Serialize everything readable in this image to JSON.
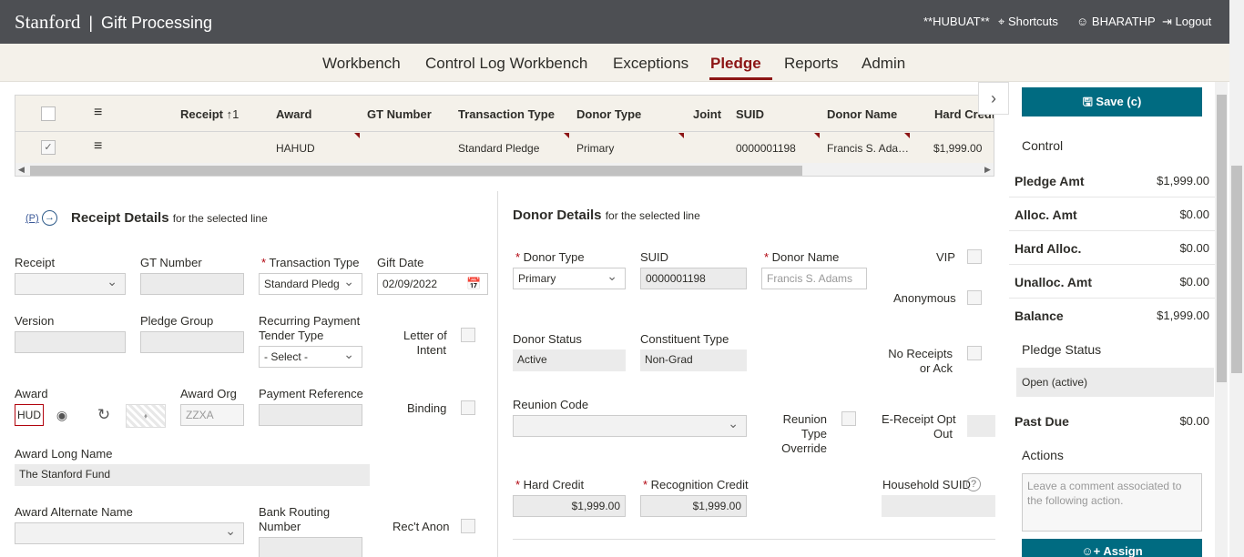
{
  "header": {
    "brand": "Stanford",
    "app_name": "Gift Processing",
    "env": "**HUBUAT**",
    "shortcuts": "Shortcuts",
    "user": "BHARATHP",
    "logout": "Logout"
  },
  "nav": {
    "items": [
      "Workbench",
      "Control Log Workbench",
      "Exceptions",
      "Pledge",
      "Reports",
      "Admin"
    ],
    "active": "Pledge"
  },
  "grid": {
    "columns": [
      "Receipt",
      "Award",
      "GT Number",
      "Transaction Type",
      "Donor Type",
      "Joint",
      "SUID",
      "Donor Name",
      "Hard Credit"
    ],
    "sort_indicator": "↑1",
    "row": {
      "award": "HAHUD",
      "transaction_type": "Standard Pledge",
      "donor_type": "Primary",
      "suid": "0000001198",
      "donor_name": "Francis S. Ada…",
      "hard_credit": "$1,999.00"
    }
  },
  "receipt": {
    "badge": "(P)",
    "title": "Receipt Details",
    "subtitle": "for the selected line",
    "labels": {
      "receipt": "Receipt",
      "gt_number": "GT Number",
      "transaction_type": "Transaction Type",
      "gift_date": "Gift Date",
      "version": "Version",
      "pledge_group": "Pledge Group",
      "recurring_1": "Recurring Payment",
      "recurring_2": "Tender Type",
      "letter_1": "Letter of",
      "letter_2": "Intent",
      "award": "Award",
      "award_org": "Award Org",
      "payment_reference": "Payment Reference",
      "binding": "Binding",
      "award_long_name": "Award Long Name",
      "award_alternate_name": "Award Alternate Name",
      "bank_1": "Bank Routing",
      "bank_2": "Number",
      "rect_anon": "Rec't Anon"
    },
    "values": {
      "transaction_type": "Standard Pledg",
      "gift_date": "02/09/2022",
      "recurring_tender": "- Select -",
      "award": "HUD",
      "award_org": "ZZXA",
      "award_long_name": "The Stanford Fund"
    }
  },
  "donor": {
    "title": "Donor Details",
    "subtitle": "for the selected line",
    "labels": {
      "donor_type": "Donor Type",
      "suid": "SUID",
      "donor_name": "Donor Name",
      "vip": "VIP",
      "anonymous": "Anonymous",
      "donor_status": "Donor Status",
      "constituent_type": "Constituent Type",
      "no_receipts_1": "No Receipts",
      "no_receipts_2": "or Ack",
      "reunion_code": "Reunion Code",
      "reunion_override_1": "Reunion",
      "reunion_override_2": "Type",
      "reunion_override_3": "Override",
      "ereceipt_1": "E-Receipt Opt",
      "ereceipt_2": "Out",
      "hard_credit": "Hard Credit",
      "recognition_credit": "Recognition Credit",
      "household_suid": "Household SUID"
    },
    "values": {
      "donor_type": "Primary",
      "suid": "0000001198",
      "donor_name": "Francis S. Adams",
      "donor_status": "Active",
      "constituent_type": "Non-Grad",
      "hard_credit": "$1,999.00",
      "recognition_credit": "$1,999.00"
    }
  },
  "control": {
    "save_label": "Save (c)",
    "control_title": "Control",
    "rows": [
      {
        "label": "Pledge Amt",
        "value": "$1,999.00"
      },
      {
        "label": "Alloc. Amt",
        "value": "$0.00"
      },
      {
        "label": "Hard Alloc.",
        "value": "$0.00"
      },
      {
        "label": "Unalloc. Amt",
        "value": "$0.00"
      },
      {
        "label": "Balance",
        "value": "$1,999.00"
      }
    ],
    "pledge_status_title": "Pledge Status",
    "pledge_status": "Open (active)",
    "past_due_label": "Past Due",
    "past_due_value": "$0.00",
    "actions_title": "Actions",
    "comment_placeholder": "Leave a comment associated to the following action.",
    "assign_label": "Assign"
  },
  "colors": {
    "header_bg": "#4d4f53",
    "nav_bg": "#f4f1ea",
    "accent": "#8c1515",
    "button": "#006b81"
  }
}
